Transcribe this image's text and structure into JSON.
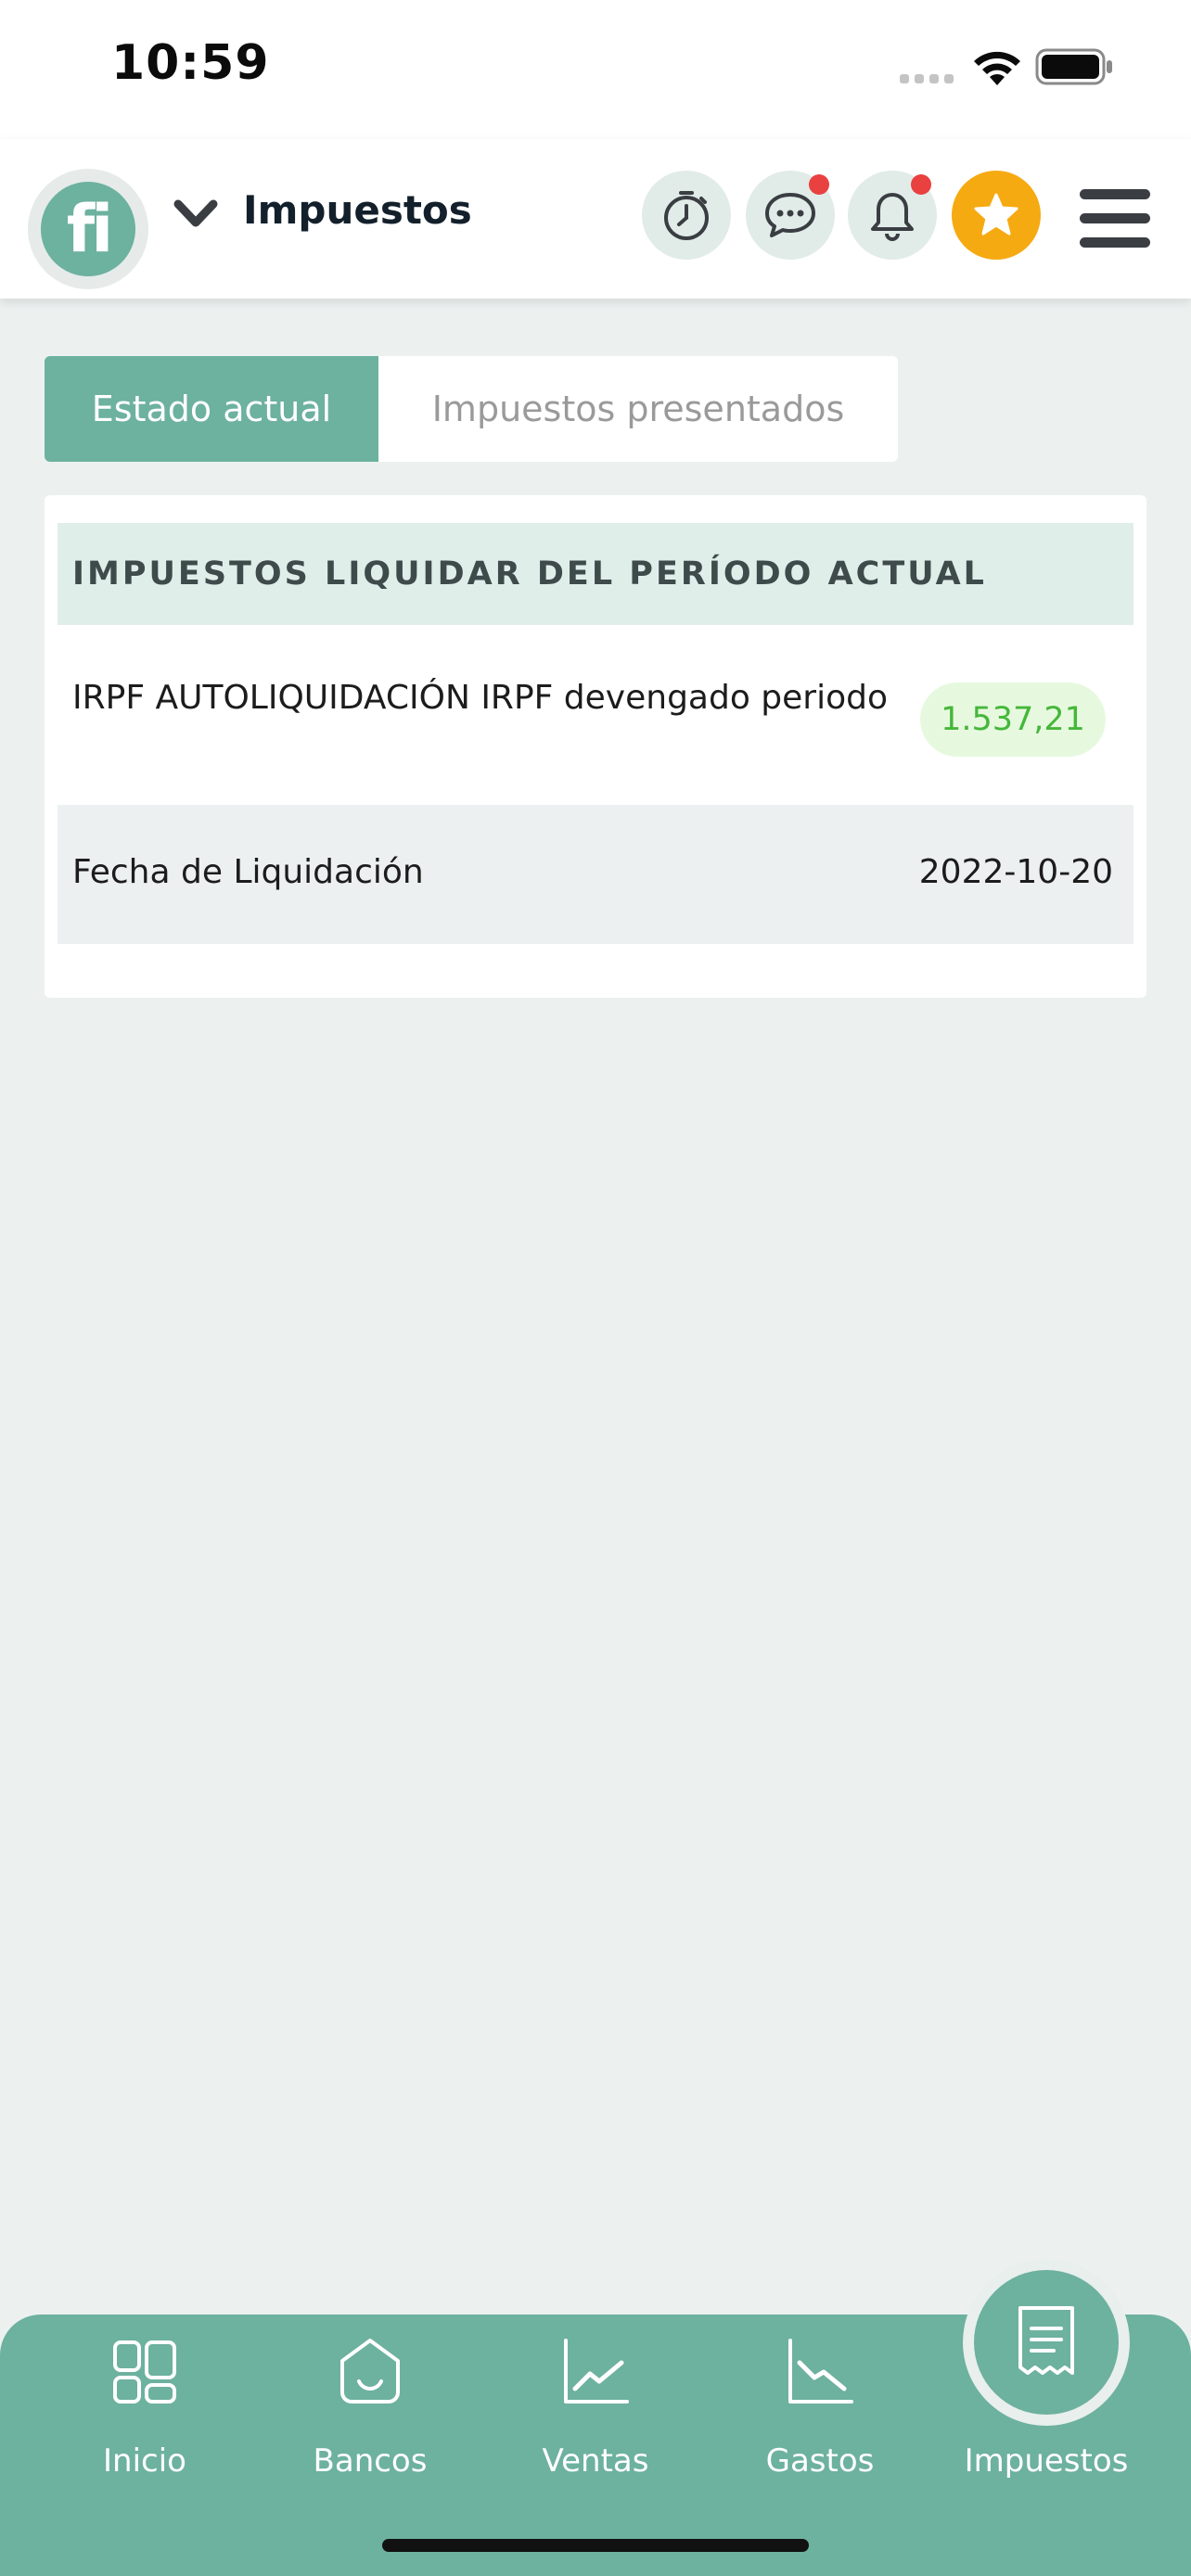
{
  "status_bar": {
    "time": "10:59"
  },
  "header": {
    "logo_text": "fi",
    "section_title": "Impuestos",
    "icons": [
      "timer-icon",
      "chat-icon",
      "bell-icon",
      "star-icon",
      "menu-icon"
    ],
    "badge_color": "#e94040",
    "star_color": "#f6aa12"
  },
  "tabs": [
    {
      "label": "Estado actual",
      "active": true
    },
    {
      "label": "Impuestos presentados",
      "active": false
    }
  ],
  "card": {
    "heading": "IMPUESTOS LIQUIDAR DEL PERÍODO ACTUAL",
    "rows": [
      {
        "label": "IRPF AUTOLIQUIDACIÓN IRPF devengado periodo",
        "value": "1.537,21"
      },
      {
        "label": "Fecha de Liquidación",
        "value": "2022-10-20"
      }
    ]
  },
  "bottom_nav": {
    "items": [
      {
        "label": "Inicio",
        "icon": "dashboard-icon"
      },
      {
        "label": "Bancos",
        "icon": "bank-icon"
      },
      {
        "label": "Ventas",
        "icon": "sales-chart-icon"
      },
      {
        "label": "Gastos",
        "icon": "expenses-chart-icon"
      },
      {
        "label": "Impuestos",
        "icon": "receipt-icon",
        "active": true
      }
    ]
  },
  "colors": {
    "accent": "#6db19f",
    "positive_amount": "#45b73a",
    "background": "#ecf1f0"
  }
}
